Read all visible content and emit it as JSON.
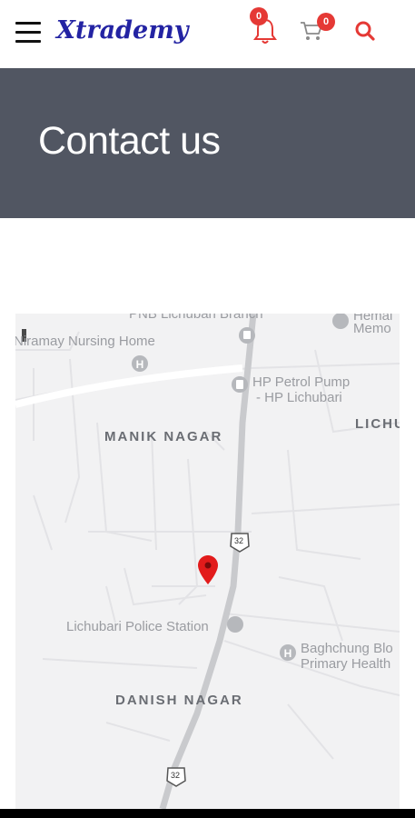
{
  "header": {
    "menu_icon": "hamburger-menu-icon",
    "logo_text": "Xtrademy",
    "notifications": {
      "icon": "bell-icon",
      "count": "0",
      "color": "#e53935"
    },
    "cart": {
      "icon": "cart-icon",
      "count": "0"
    },
    "search": {
      "icon": "search-icon",
      "color": "#e53935"
    }
  },
  "hero": {
    "title": "Contact us",
    "background": "#515662"
  },
  "map": {
    "labels": {
      "pnb": "PNB Lichubari Branch",
      "hemal": "Hemal",
      "memo": "Memo",
      "niramay": "Niramay Nursing Home",
      "hp_1": "HP Petrol Pump",
      "hp_2": "- HP Lichubari",
      "manik": "MANIK NAGAR",
      "lichu": "LICHU",
      "highway_1": "32",
      "police": "Lichubari Police Station",
      "baghchung_1": "Baghchung Blo",
      "baghchung_2": "Primary Health",
      "danish": "DANISH NAGAR",
      "highway_2": "32"
    },
    "pin": {
      "icon": "location-pin-icon",
      "color": "#e21b1b"
    }
  }
}
